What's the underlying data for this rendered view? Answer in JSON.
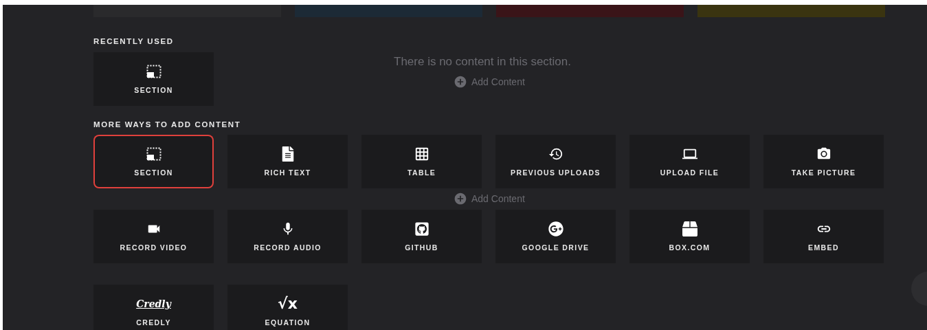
{
  "course_cards": [
    {
      "color": "#2a2a2c"
    },
    {
      "color": "#1c2a36"
    },
    {
      "color": "#3a1418"
    },
    {
      "color": "#3a3410"
    }
  ],
  "background": {
    "empty_message": "There is no content in this section.",
    "add_links": [
      "Add Content",
      "Add Content"
    ]
  },
  "recently_used": {
    "heading": "RECENTLY USED",
    "tiles": [
      {
        "kind": "section",
        "label": "SECTION",
        "selected": false
      }
    ]
  },
  "more_ways": {
    "heading": "MORE WAYS TO ADD CONTENT",
    "tiles": [
      {
        "kind": "section",
        "label": "SECTION",
        "selected": true
      },
      {
        "kind": "richtext",
        "label": "RICH TEXT",
        "selected": false
      },
      {
        "kind": "table",
        "label": "TABLE",
        "selected": false
      },
      {
        "kind": "history",
        "label": "PREVIOUS UPLOADS",
        "selected": false
      },
      {
        "kind": "laptop",
        "label": "UPLOAD FILE",
        "selected": false
      },
      {
        "kind": "camera",
        "label": "TAKE PICTURE",
        "selected": false
      },
      {
        "kind": "video",
        "label": "RECORD VIDEO",
        "selected": false
      },
      {
        "kind": "mic",
        "label": "RECORD AUDIO",
        "selected": false
      },
      {
        "kind": "github",
        "label": "GITHUB",
        "selected": false
      },
      {
        "kind": "gplus",
        "label": "GOOGLE DRIVE",
        "selected": false
      },
      {
        "kind": "box",
        "label": "BOX.COM",
        "selected": false
      },
      {
        "kind": "link",
        "label": "EMBED",
        "selected": false
      },
      {
        "kind": "logo",
        "logo": "Credly",
        "label": "CREDLY",
        "selected": false
      },
      {
        "kind": "glyph",
        "glyph": "√x",
        "label": "EQUATION",
        "selected": false
      }
    ]
  }
}
